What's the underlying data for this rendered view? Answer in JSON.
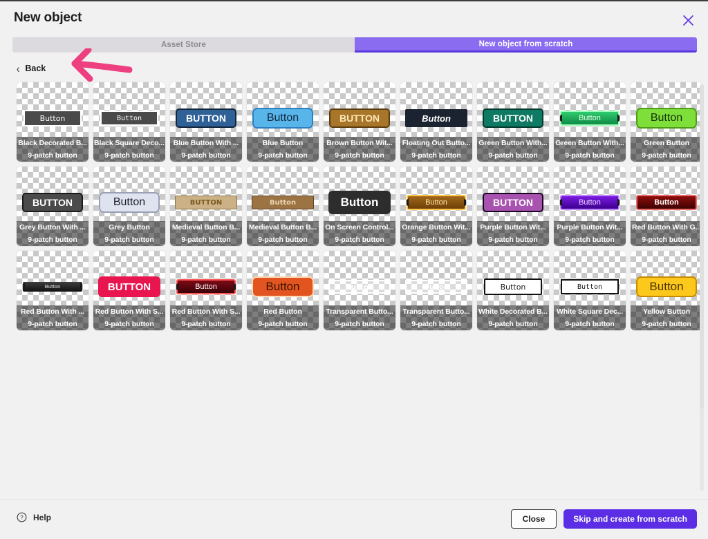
{
  "window": {
    "title": "New object",
    "close_icon": "close-icon"
  },
  "tabs": [
    {
      "label": "Asset Store",
      "active": false
    },
    {
      "label": "New object from scratch",
      "active": true
    }
  ],
  "back": {
    "label": "Back",
    "icon": "chevron-left-icon"
  },
  "annotation": {
    "type": "hand-drawn-arrow",
    "color": "#ee3f80",
    "points_to": "Back"
  },
  "colors": {
    "accent": "#8a6cf0",
    "accent_dark": "#5b2ee5",
    "tab_inactive_bg": "#dcdade",
    "page_bg": "#f1f1f1",
    "annotation_pink": "#ee3f80"
  },
  "grid": {
    "kind_label": "9-patch button",
    "items": [
      {
        "name": "Black Decorated B...",
        "kind": "9-patch button",
        "text": "Button",
        "style": "black-decorated"
      },
      {
        "name": "Black Square Deco...",
        "kind": "9-patch button",
        "text": "Button",
        "style": "black-square"
      },
      {
        "name": "Blue Button With ...",
        "kind": "9-patch button",
        "text": "BUTTON",
        "style": "blue-dark"
      },
      {
        "name": "Blue Button",
        "kind": "9-patch button",
        "text": "Button",
        "style": "blue-light"
      },
      {
        "name": "Brown Button Wit...",
        "kind": "9-patch button",
        "text": "BUTTON",
        "style": "brown"
      },
      {
        "name": "Floating Out Butto...",
        "kind": "9-patch button",
        "text": "Button",
        "style": "floating-dark"
      },
      {
        "name": "Green Button With...",
        "kind": "9-patch button",
        "text": "BUTTON",
        "style": "green-teal"
      },
      {
        "name": "Green Button With...",
        "kind": "9-patch button",
        "text": "Button",
        "style": "green-glow"
      },
      {
        "name": "Green Button",
        "kind": "9-patch button",
        "text": "Button",
        "style": "green-bright"
      },
      {
        "name": "Grey Button With ...",
        "kind": "9-patch button",
        "text": "BUTTON",
        "style": "grey-dark"
      },
      {
        "name": "Grey Button",
        "kind": "9-patch button",
        "text": "Button",
        "style": "grey-light"
      },
      {
        "name": "Medieval Button B...",
        "kind": "9-patch button",
        "text": "BUTTON",
        "style": "medieval-tan"
      },
      {
        "name": "Medieval Button B...",
        "kind": "9-patch button",
        "text": "Button",
        "style": "medieval-brown"
      },
      {
        "name": "On Screen Control...",
        "kind": "9-patch button",
        "text": "Button",
        "style": "onscreen-dark"
      },
      {
        "name": "Orange Button Wit...",
        "kind": "9-patch button",
        "text": "Button",
        "style": "orange-glow"
      },
      {
        "name": "Purple Button Wit...",
        "kind": "9-patch button",
        "text": "BUTTON",
        "style": "purple-plain"
      },
      {
        "name": "Purple Button Wit...",
        "kind": "9-patch button",
        "text": "Button",
        "style": "purple-glow"
      },
      {
        "name": "Red Button With G...",
        "kind": "9-patch button",
        "text": "Button",
        "style": "red-gradient"
      },
      {
        "name": "Red Button With ...",
        "kind": "9-patch button",
        "text": "Button",
        "style": "red-dark-thin"
      },
      {
        "name": "Red Button With S...",
        "kind": "9-patch button",
        "text": "BUTTON",
        "style": "red-pink"
      },
      {
        "name": "Red Button With S...",
        "kind": "9-patch button",
        "text": "Button",
        "style": "red-deep"
      },
      {
        "name": "Red Button",
        "kind": "9-patch button",
        "text": "Button",
        "style": "red-orange"
      },
      {
        "name": "Transparent Butto...",
        "kind": "9-patch button",
        "text": "Button",
        "style": "transparent-a"
      },
      {
        "name": "Transparent Butto...",
        "kind": "9-patch button",
        "text": "Button",
        "style": "transparent-b"
      },
      {
        "name": "White Decorated B...",
        "kind": "9-patch button",
        "text": "Button",
        "style": "white-decorated"
      },
      {
        "name": "White Square Dec...",
        "kind": "9-patch button",
        "text": "Button",
        "style": "white-square"
      },
      {
        "name": "Yellow Button",
        "kind": "9-patch button",
        "text": "Button",
        "style": "yellow"
      }
    ]
  },
  "footer": {
    "help_label": "Help",
    "help_icon": "question-circle-icon",
    "close_label": "Close",
    "skip_label": "Skip and create from scratch"
  }
}
